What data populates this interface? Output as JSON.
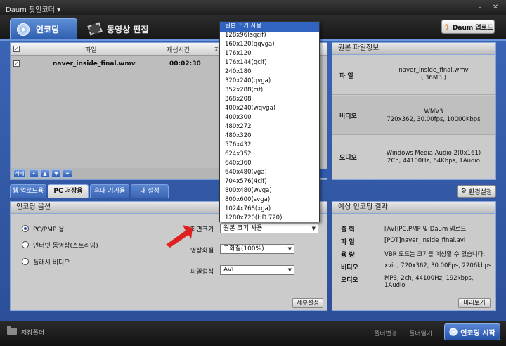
{
  "window": {
    "title": "Daum 팟인코더 ▾",
    "min": "–",
    "close": "✕"
  },
  "tabs": {
    "encoding": "인코딩",
    "edit": "동영상 편집"
  },
  "upload_button": "Daum 업로드",
  "file_list": {
    "headers": {
      "file": "파일",
      "duration": "재생시간",
      "extra": "자"
    },
    "rows": [
      {
        "name": "naver_inside_final.wmv",
        "duration": "00:02:30"
      }
    ],
    "delete_label": "삭제"
  },
  "original_info": {
    "title": "원본 파일정보",
    "file_label": "파 일",
    "file_name": "naver_inside_final.wmv",
    "file_size": "( 36MB )",
    "video_label": "비디오",
    "video_codec": "WMV3",
    "video_detail": "720x362, 30.00fps, 10000Kbps",
    "audio_label": "오디오",
    "audio_codec": "Windows Media Audio 2(0x161)",
    "audio_detail": "2Ch, 44100Hz, 64Kbps, 1Audio"
  },
  "subtabs": [
    "웹 업로드용",
    "PC 저장용",
    "휴대 기기용",
    "내 설정"
  ],
  "env_settings": "환경설정",
  "options": {
    "title": "인코딩 옵션",
    "radios": [
      "PC/PMP 용",
      "인터넷 동영상(스트리밍)",
      "플래시 비디오"
    ],
    "screen_size_label": "화면크기",
    "screen_size_value": "원본 크기 사용",
    "quality_label": "영상화질",
    "quality_value": "고화질(100%)",
    "format_label": "파일형식",
    "format_value": "AVI",
    "detail_button": "세부설정"
  },
  "result": {
    "title": "예상 인코딩 결과",
    "rows": [
      {
        "label": "출 력",
        "value": "[AVI]PC,PMP 및 Daum 업로드"
      },
      {
        "label": "파 일",
        "value": "[POT]naver_inside_final.avi"
      },
      {
        "label": "용 량",
        "value": "VBR 모드는 크기를 예상할 수 없습니다."
      },
      {
        "label": "비디오",
        "value": "xvid, 720x362, 30.00Fps, 2206kbps"
      },
      {
        "label": "오디오",
        "value": "MP3, 2ch, 44100Hz, 192kbps, 1Audio"
      }
    ],
    "preview_button": "미리보기"
  },
  "footer": {
    "save_folder": "저장폴더",
    "link1": "폴더변경",
    "link2": "폴더열기",
    "start_button": "인코딩 시작"
  },
  "dropdown": {
    "selected_index": 0,
    "items": [
      "원본 크기 사용",
      "128x96(sqcif)",
      "160x120(qqvga)",
      "176x120",
      "176x144(qcif)",
      "240x180",
      "320x240(qvga)",
      "352x288(cif)",
      "368x208",
      "400x240(wqvga)",
      "400x300",
      "480x272",
      "480x320",
      "576x432",
      "624x352",
      "640x360",
      "640x480(vga)",
      "704x576(4cif)",
      "800x480(wvga)",
      "800x600(svga)",
      "1024x768(xga)",
      "1280x720(HD 720)"
    ]
  },
  "colors": {
    "accent_blue": "#2c4f99",
    "selection": "#3064c0",
    "arrow_red": "#e02020"
  }
}
